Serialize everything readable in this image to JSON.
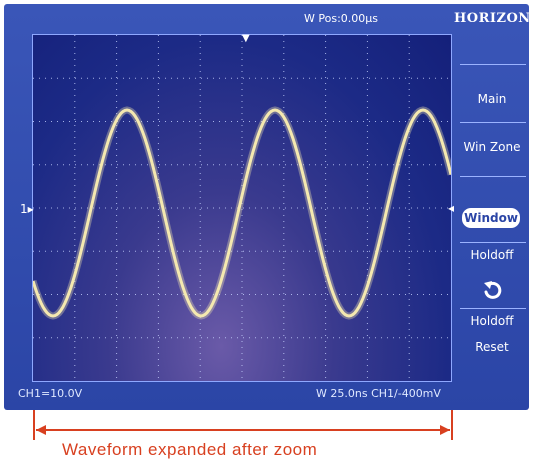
{
  "top_bar": {
    "status_left": "",
    "trigger_status": "",
    "wpos_readout": "W Pos:0.00μs",
    "menu_title": "HORIZON"
  },
  "side_menu": {
    "items": [
      {
        "label": "Main"
      },
      {
        "label": "Win Zone"
      },
      {
        "label": "Window"
      },
      {
        "label": "Holdoff"
      },
      {
        "label": "Holdoff"
      },
      {
        "label": "Reset"
      }
    ]
  },
  "bottom_bar": {
    "ch1_scale": "CH1=10.0V",
    "time_trigger_readout": "W 25.0ns CH1/-400mV"
  },
  "annotation": {
    "label": "Waveform  expanded  after  zoom"
  },
  "colors": {
    "panel": "#2b45a6",
    "trace": "#f4e8b0",
    "annotation": "#d84020"
  }
}
